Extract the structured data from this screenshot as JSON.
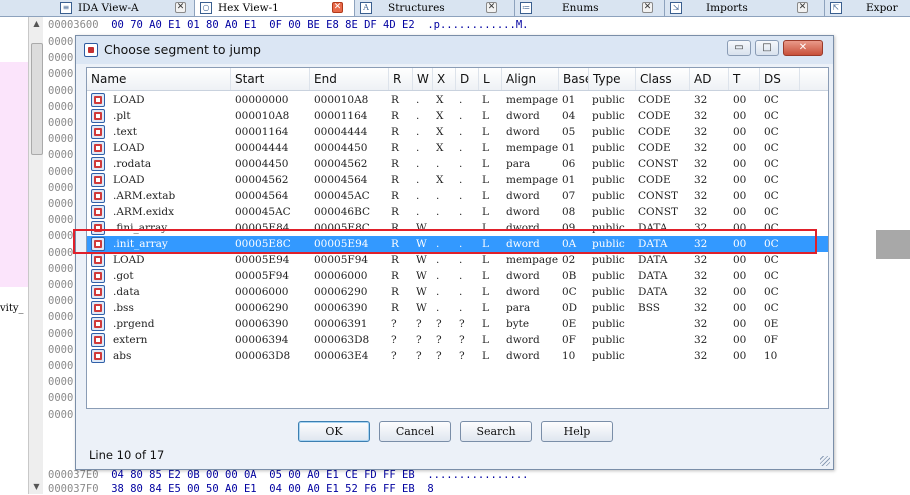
{
  "tabs": [
    {
      "label": "IDA View-A",
      "icon": "listing-icon"
    },
    {
      "label": "Hex View-1",
      "icon": "hex-view-icon"
    },
    {
      "label": "Structures",
      "icon": "structures-icon"
    },
    {
      "label": "Enums",
      "icon": "enums-icon"
    },
    {
      "label": "Imports",
      "icon": "imports-icon"
    },
    {
      "label": "Expor",
      "icon": "exports-icon"
    }
  ],
  "left_pane": {
    "label": "vity_"
  },
  "hex_view": {
    "lines": [
      {
        "addr": "00003600",
        "bytes": "00 70 A0 E1 01 80 A0 E1  0F 00 BE E8 8E DF 4D E2",
        "ascii": ".p............M."
      },
      {
        "addr": "000037E0",
        "bytes": "04 80 85 E2 0B 00 00 0A  05 00 A0 E1 CE FD FF EB",
        "ascii": "................"
      },
      {
        "addr": "000037F0",
        "bytes": "38 80 84 E5 00 50 A0 E1  04 00 A0 E1 52 F6 FF EB",
        "ascii": "8"
      }
    ],
    "left_addr_prefix": [
      "0000",
      "0000",
      "0000",
      "0000",
      "0000",
      "0000",
      "0000",
      "0000",
      "0000",
      "0000",
      "0000",
      "0000",
      "0000",
      "0000",
      "0000",
      "0000",
      "0000",
      "0000",
      "0000",
      "0000",
      "0000",
      "0000",
      "0000",
      "0000"
    ]
  },
  "dialog": {
    "title": "Choose segment to jump",
    "window_buttons": {
      "minimize": "▭",
      "maximize": "□",
      "close": "✕"
    },
    "columns": [
      "Name",
      "Start",
      "End",
      "R",
      "W",
      "X",
      "D",
      "L",
      "Align",
      "Base",
      "Type",
      "Class",
      "AD",
      "T",
      "DS"
    ],
    "rows": [
      [
        "LOAD",
        "00000000",
        "000010A8",
        "R",
        ".",
        "X",
        ".",
        "L",
        "mempage",
        "01",
        "public",
        "CODE",
        "32",
        "00",
        "0C"
      ],
      [
        ".plt",
        "000010A8",
        "00001164",
        "R",
        ".",
        "X",
        ".",
        "L",
        "dword",
        "04",
        "public",
        "CODE",
        "32",
        "00",
        "0C"
      ],
      [
        ".text",
        "00001164",
        "00004444",
        "R",
        ".",
        "X",
        ".",
        "L",
        "dword",
        "05",
        "public",
        "CODE",
        "32",
        "00",
        "0C"
      ],
      [
        "LOAD",
        "00004444",
        "00004450",
        "R",
        ".",
        "X",
        ".",
        "L",
        "mempage",
        "01",
        "public",
        "CODE",
        "32",
        "00",
        "0C"
      ],
      [
        ".rodata",
        "00004450",
        "00004562",
        "R",
        ".",
        ".",
        ".",
        "L",
        "para",
        "06",
        "public",
        "CONST",
        "32",
        "00",
        "0C"
      ],
      [
        "LOAD",
        "00004562",
        "00004564",
        "R",
        ".",
        "X",
        ".",
        "L",
        "mempage",
        "01",
        "public",
        "CODE",
        "32",
        "00",
        "0C"
      ],
      [
        ".ARM.extab",
        "00004564",
        "000045AC",
        "R",
        ".",
        ".",
        ".",
        "L",
        "dword",
        "07",
        "public",
        "CONST",
        "32",
        "00",
        "0C"
      ],
      [
        ".ARM.exidx",
        "000045AC",
        "000046BC",
        "R",
        ".",
        ".",
        ".",
        "L",
        "dword",
        "08",
        "public",
        "CONST",
        "32",
        "00",
        "0C"
      ],
      [
        ".fini_array",
        "00005E84",
        "00005E8C",
        "R",
        "W",
        ".",
        ".",
        "L",
        "dword",
        "09",
        "public",
        "DATA",
        "32",
        "00",
        "0C"
      ],
      [
        ".init_array",
        "00005E8C",
        "00005E94",
        "R",
        "W",
        ".",
        ".",
        "L",
        "dword",
        "0A",
        "public",
        "DATA",
        "32",
        "00",
        "0C"
      ],
      [
        "LOAD",
        "00005E94",
        "00005F94",
        "R",
        "W",
        ".",
        ".",
        "L",
        "mempage",
        "02",
        "public",
        "DATA",
        "32",
        "00",
        "0C"
      ],
      [
        ".got",
        "00005F94",
        "00006000",
        "R",
        "W",
        ".",
        ".",
        "L",
        "dword",
        "0B",
        "public",
        "DATA",
        "32",
        "00",
        "0C"
      ],
      [
        ".data",
        "00006000",
        "00006290",
        "R",
        "W",
        ".",
        ".",
        "L",
        "dword",
        "0C",
        "public",
        "DATA",
        "32",
        "00",
        "0C"
      ],
      [
        ".bss",
        "00006290",
        "00006390",
        "R",
        "W",
        ".",
        ".",
        "L",
        "para",
        "0D",
        "public",
        "BSS",
        "32",
        "00",
        "0C"
      ],
      [
        ".prgend",
        "00006390",
        "00006391",
        "?",
        "?",
        "?",
        "?",
        "L",
        "byte",
        "0E",
        "public",
        "",
        "32",
        "00",
        "0E"
      ],
      [
        "extern",
        "00006394",
        "000063D8",
        "?",
        "?",
        "?",
        "?",
        "L",
        "dword",
        "0F",
        "public",
        "",
        "32",
        "00",
        "0F"
      ],
      [
        "abs",
        "000063D8",
        "000063E4",
        "?",
        "?",
        "?",
        "?",
        "L",
        "dword",
        "10",
        "public",
        "",
        "32",
        "00",
        "10"
      ]
    ],
    "selected_row": 9,
    "buttons": {
      "ok": "OK",
      "cancel": "Cancel",
      "search": "Search",
      "help": "Help"
    },
    "status": "Line 10 of 17"
  },
  "colors": {
    "selection": "#3399ff",
    "highlight_box": "#e0202a"
  }
}
